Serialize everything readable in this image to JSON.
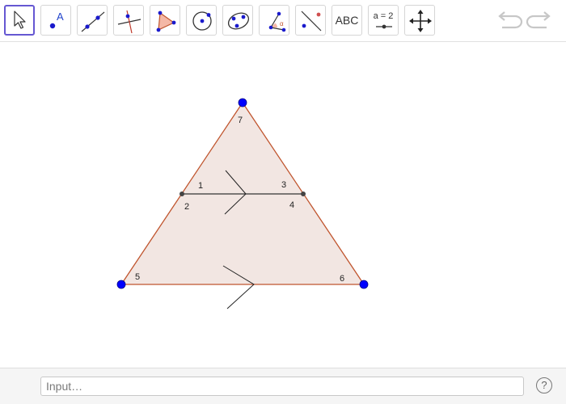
{
  "toolbar": {
    "tools": [
      {
        "name": "move-tool",
        "icon": "arrow-cursor-icon"
      },
      {
        "name": "point-tool",
        "icon": "point-icon",
        "text": "A"
      },
      {
        "name": "line-tool",
        "icon": "line-icon"
      },
      {
        "name": "perpendicular-line-tool",
        "icon": "perpendicular-icon"
      },
      {
        "name": "polygon-tool",
        "icon": "polygon-icon"
      },
      {
        "name": "circle-tool",
        "icon": "circle-icon"
      },
      {
        "name": "conic-tool",
        "icon": "ellipse-icon"
      },
      {
        "name": "angle-tool",
        "icon": "angle-icon",
        "text": "α"
      },
      {
        "name": "reflect-tool",
        "icon": "reflect-icon"
      },
      {
        "name": "text-tool",
        "icon": "text-icon",
        "text": "ABC"
      },
      {
        "name": "slider-tool",
        "icon": "slider-icon",
        "text": "a = 2"
      },
      {
        "name": "move-graphics-view-tool",
        "icon": "move-arrows-icon"
      }
    ],
    "selected_tool": "move-tool",
    "undo_icon": "undo-icon",
    "redo_icon": "redo-icon"
  },
  "graphics": {
    "angle_labels": [
      "1",
      "2",
      "3",
      "4",
      "5",
      "6",
      "7"
    ],
    "colors": {
      "fill": "#f2e6e2",
      "edge": "#c0552e",
      "vertex": "#0000ff",
      "midpoint": "#444444",
      "segment": "#333333"
    }
  },
  "input_bar": {
    "placeholder": "Input…"
  },
  "help": {
    "icon": "help-icon",
    "label": "?"
  }
}
